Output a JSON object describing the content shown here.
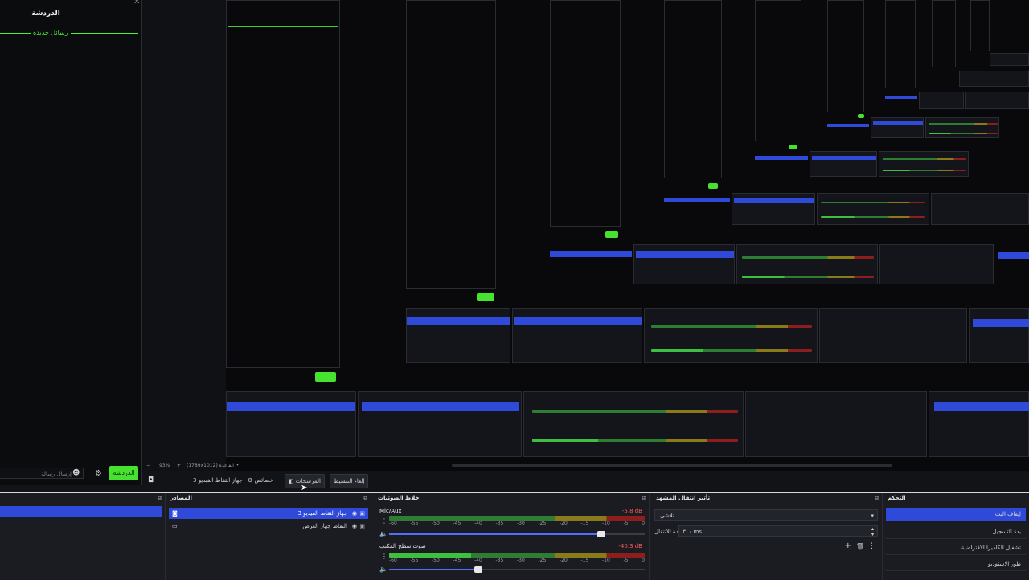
{
  "chat": {
    "title": "الدردشة",
    "new_messages": "رسائل جديدة",
    "send_label": "الدردشة",
    "input_placeholder": "إرسال رسالة"
  },
  "statusbar": {
    "zoom": "93%",
    "resolution": "القاعدة (1789x1012)"
  },
  "toolbar": {
    "scene_name": "جهاز التقاط الفيديو 3",
    "properties_label": "خصائص",
    "filters_label": "المرشحات",
    "deactivate_label": "إلغاء التنشيط"
  },
  "docks": {
    "scenes_title": "",
    "sources": {
      "title": "المصادر",
      "items": [
        {
          "label": "جهاز التقاط الفيديو 3",
          "selected": true
        },
        {
          "label": "التقاط جهاز العرض",
          "selected": false
        }
      ]
    },
    "mixer": {
      "title": "خلاط الصوتيات",
      "ticks": [
        "-60",
        "-55",
        "-50",
        "-45",
        "-40",
        "-35",
        "-30",
        "-25",
        "-20",
        "-15",
        "-10",
        "-5",
        "0"
      ],
      "channels": [
        {
          "name": "Mic/Aux",
          "db": "-5.8 dB",
          "level": 0.83
        },
        {
          "name": "صوت سطح المكتب",
          "db": "-40.3 dB",
          "level": 0.35
        }
      ]
    },
    "transitions": {
      "title": "تأثير انتقال المشهد",
      "type_value": "تلاشي",
      "duration_label": "مدة الانتقال",
      "duration_value": "٣٠٠ ms"
    },
    "controls": {
      "title": "التحكم",
      "buttons": [
        {
          "label": "إيقاف البث",
          "active": true
        },
        {
          "label": "بدء التسجيل",
          "active": false
        },
        {
          "label": "تشغيل الكاميرا الافتراضية",
          "active": false
        },
        {
          "label": "طور الاستوديو",
          "active": false
        }
      ]
    }
  },
  "colors": {
    "accent_blue": "#2f49d8",
    "live_green": "#47e22f",
    "background": "#121317"
  }
}
